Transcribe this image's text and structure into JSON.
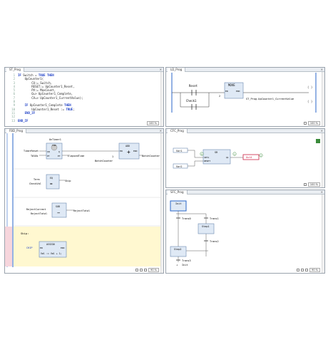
{
  "st": {
    "tab": "ST_Prog",
    "zoom": "100 %",
    "lines": [
      {
        "n": "1",
        "t": "IF Switch = TRUE THEN"
      },
      {
        "n": "2",
        "t": "    UpCounter1("
      },
      {
        "n": "3",
        "t": "        CU:= Switch,"
      },
      {
        "n": "4",
        "t": "        RESET:= UpCounter1_Reset,"
      },
      {
        "n": "5",
        "t": "        PV:= MaxCount,"
      },
      {
        "n": "6",
        "t": "        Q=> UpCounter1_Complete,"
      },
      {
        "n": "7",
        "t": "        CV=> UpCounter1_CurrentValue);"
      },
      {
        "n": "8",
        "t": ""
      },
      {
        "n": "9",
        "t": "    IF UpCounter1_Complete THEN"
      },
      {
        "n": "10",
        "t": "        UpCounter1_Reset := TRUE;"
      },
      {
        "n": "11",
        "t": "    END_IF"
      },
      {
        "n": "12",
        "t": ""
      },
      {
        "n": "13",
        "t": "END_IF"
      }
    ]
  },
  "ld": {
    "tab": "LD_Prog",
    "zoom": "100 %",
    "contact1": "Reset",
    "contact2": "Check1",
    "block": "MOVE",
    "en": "EN",
    "eno": "ENO",
    "pin_in": "2",
    "output": "ST_Prog.UpCounter1_CurrentValue"
  },
  "fbd": {
    "tab": "FBD_Prog",
    "zoom": "90 %",
    "ton_instance": "OnTimer1",
    "ton_name": "TON",
    "ton_in": "IN",
    "ton_pt": "PT",
    "ton_q": "Q",
    "ton_et": "ET",
    "timer_reset": "TimerReset",
    "tmin": "T#10s",
    "elapsed": "ElapsedTime",
    "add_name": "ADD",
    "en": "EN",
    "eno": "ENO",
    "add_const": "1",
    "add_in2": "BatchCounter",
    "add_out": "BatchCounter",
    "eq_name": "EQ",
    "eq_in1": "Term",
    "eq_in2": "CheckVal",
    "eq_out": "Skip",
    "sub_name": "SUB",
    "sub_in1": "RejectCurrent",
    "sub_in2": "RejectTotal",
    "sub_out": "RejectTotal",
    "label": "Skip:",
    "assign_name": "ASSIGN",
    "assign_in": "CHIP",
    "assign_expr": "Val := Val + 1;"
  },
  "cfc": {
    "tab": "CFC_Prog",
    "zoom": "100 %",
    "in1": "Var1",
    "in2": "Var2",
    "block": "SR",
    "pin_set": "SET1",
    "pin_reset": "RESET",
    "pin_q": "Q1",
    "output": "Out4",
    "num1": "0",
    "num2": "1",
    "num3": "2"
  },
  "sfc": {
    "tab": "SFC_Prog",
    "zoom": "90 %",
    "init": "Init",
    "t1": "Trans0",
    "t2": "Trans1",
    "t3": "Trans2",
    "step1": "Step1",
    "step2": "Step2",
    "jump": "Trans3",
    "jump_to": "Init"
  },
  "colors": {
    "keyword": "#1a3cc5",
    "block_fill": "#dfe9f5",
    "block_border": "#6b88b0",
    "active": "#cc2244",
    "sfc_comment": "#fff8d0"
  }
}
